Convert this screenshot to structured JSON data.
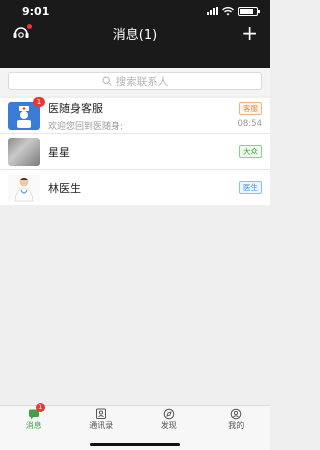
{
  "status": {
    "time": "9:01"
  },
  "navbar": {
    "title": "消息(1)",
    "add_icon": "plus-icon"
  },
  "search": {
    "placeholder": "搜索联系人"
  },
  "messages": [
    {
      "name": "医随身客服",
      "preview": "欢迎您回到医随身:",
      "tag": "客服",
      "time": "08:54",
      "badge": "1"
    },
    {
      "name": "星星",
      "preview": "",
      "tag": "大众",
      "time": "",
      "badge": ""
    },
    {
      "name": "林医生",
      "preview": "",
      "tag": "医生",
      "time": "",
      "badge": ""
    }
  ],
  "tabs": [
    {
      "label": "消息",
      "badge": "1"
    },
    {
      "label": "通讯录"
    },
    {
      "label": "发现"
    },
    {
      "label": "我的"
    }
  ],
  "colors": {
    "accent": "#43a047",
    "badge": "#e53935",
    "header": "#1a1a1a"
  }
}
